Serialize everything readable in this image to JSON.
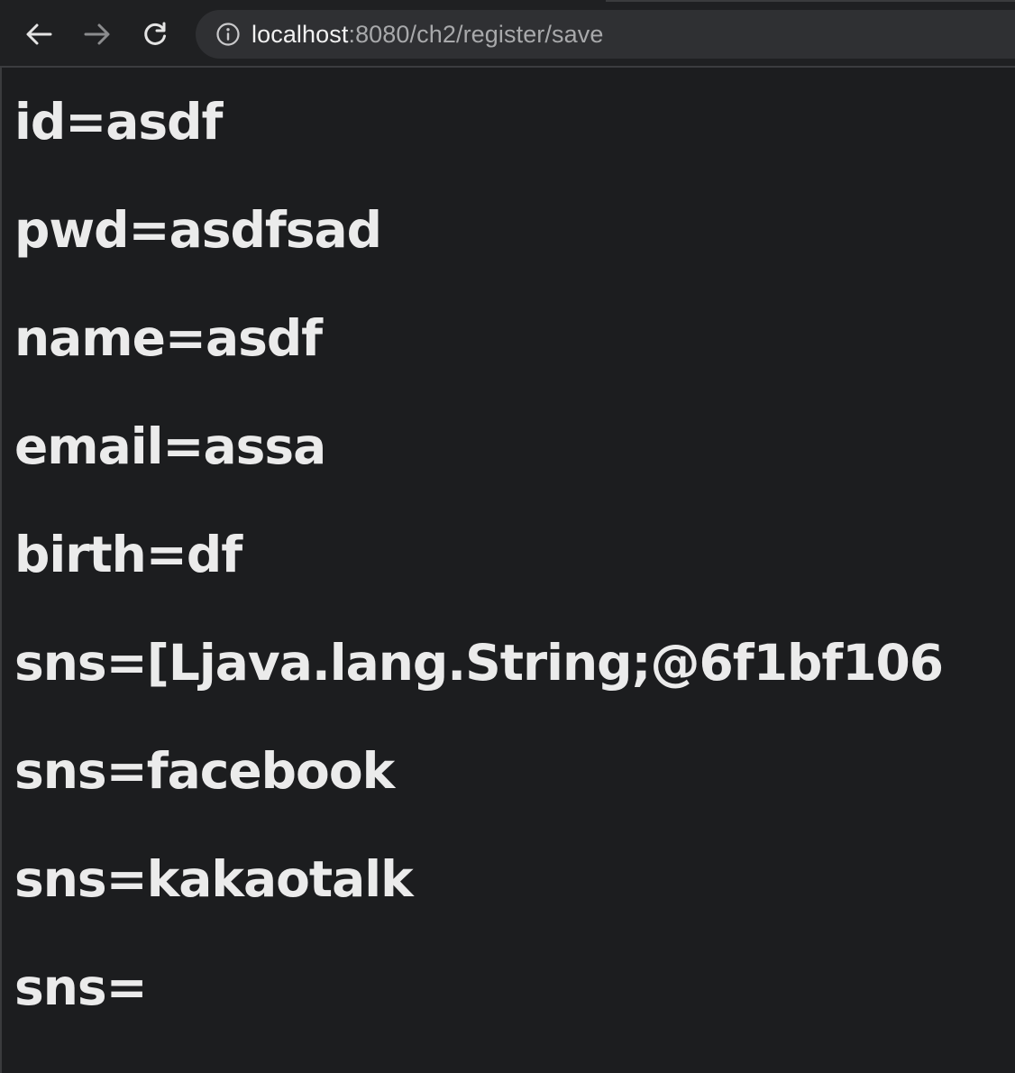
{
  "browser": {
    "url_host": "localhost",
    "url_path": ":8080/ch2/register/save",
    "icons": {
      "back": "back-arrow-icon",
      "forward": "forward-arrow-icon",
      "reload": "reload-icon",
      "site_info": "info-icon"
    }
  },
  "page": {
    "lines": [
      "id=asdf",
      "pwd=asdfsad",
      "name=asdf",
      "email=assa",
      "birth=df",
      "sns=[Ljava.lang.String;@6f1bf106",
      "sns=facebook",
      "sns=kakaotalk",
      "sns="
    ]
  },
  "colors": {
    "background": "#1c1d1f",
    "text": "#ebebeb",
    "omnibox": "#2f3033",
    "url_path": "#a8a9ab"
  }
}
